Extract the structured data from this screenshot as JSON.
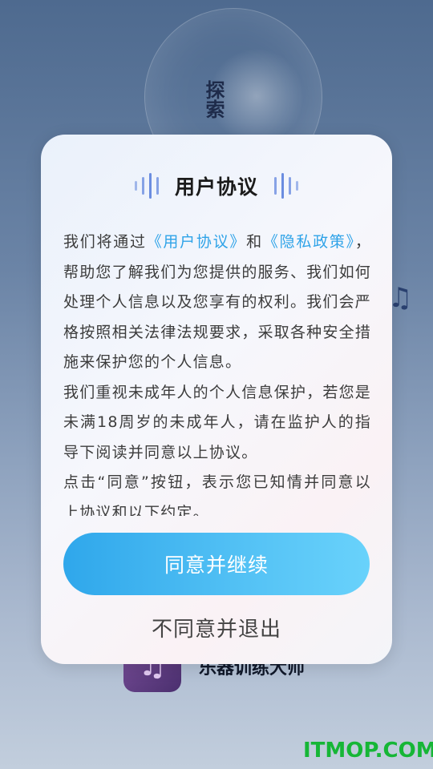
{
  "background": {
    "vertical_title": "探索",
    "app_name": "乐器训练大师",
    "music_icon": "music-note-icon"
  },
  "dialog": {
    "title": "用户协议",
    "body": {
      "p1_a": "我们将通过",
      "user_agreement_link": "《用户协议》",
      "p1_b": "和",
      "privacy_link": "《隐私政策》",
      "p1_c": "，帮助您了解我们为您提供的服务、我们如何处理个人信息以及您享有的权利。我们会严格按照相关法律法规要求，采取各种安全措施来保护您的个人信息。",
      "p2": "我们重视未成年人的个人信息保护，若您是未满18周岁的未成年人，请在监护人的指导下阅读并同意以上协议。",
      "p3": "点击“同意”按钮，表示您已知情并同意以上协议和以下约定。"
    },
    "agree_label": "同意并继续",
    "disagree_label": "不同意并退出"
  },
  "watermark": "ITMOP.COM",
  "colors": {
    "link": "#2fa3e8",
    "agree_button": "#2fa7eb",
    "watermark": "#16b636"
  }
}
